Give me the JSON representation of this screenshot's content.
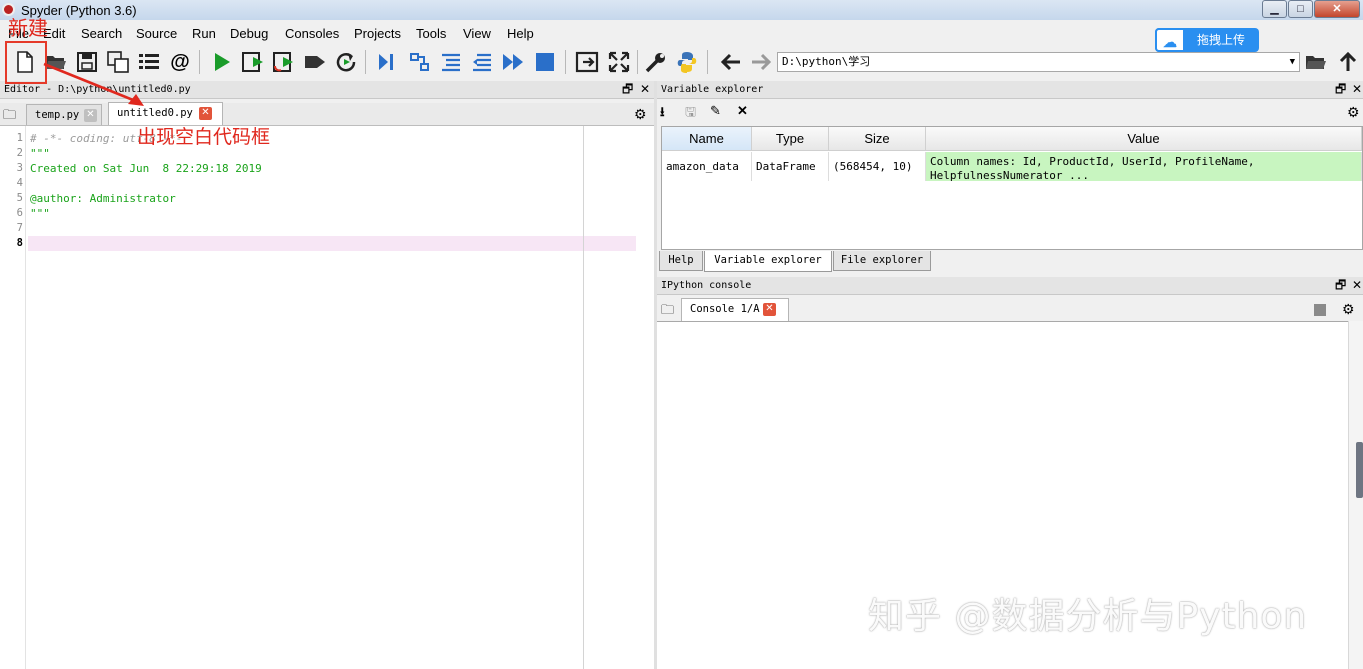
{
  "window": {
    "title": "Spyder (Python 3.6)",
    "min_label": "▁",
    "max_label": "□",
    "close_label": "✕"
  },
  "menu": [
    "File",
    "Edit",
    "Search",
    "Source",
    "Run",
    "Debug",
    "Consoles",
    "Projects",
    "Tools",
    "View",
    "Help"
  ],
  "cloud_button": {
    "label": "拖拽上传"
  },
  "toolbar": {
    "path": "D:\\python\\学习"
  },
  "editor": {
    "header": "Editor - D:\\python\\untitled0.py",
    "tabs": [
      {
        "label": "temp.py",
        "active": false
      },
      {
        "label": "untitled0.py",
        "active": true
      }
    ],
    "lines": [
      "# -*- coding: utf-8 -*-",
      "\"\"\"",
      "Created on Sat Jun  8 22:29:18 2019",
      "",
      "@author: Administrator",
      "\"\"\"",
      "",
      ""
    ],
    "line_numbers": [
      "1",
      "2",
      "3",
      "4",
      "5",
      "6",
      "7",
      "8"
    ],
    "current_line": "8"
  },
  "variable_explorer": {
    "header": "Variable explorer",
    "columns": [
      "Name",
      "Type",
      "Size",
      "Value"
    ],
    "rows": [
      {
        "name": "amazon_data",
        "type": "DataFrame",
        "size": "(568454, 10)",
        "value_line1": "Column names: Id, ProductId, UserId, ProfileName,",
        "value_line2": "HelpfulnessNumerator ..."
      }
    ],
    "bottom_tabs": [
      "Help",
      "Variable explorer",
      "File explorer"
    ],
    "active_tab": "Variable explorer"
  },
  "console": {
    "header": "IPython console",
    "tab_label": "Console 1/A"
  },
  "annotations": {
    "new_label": "新建",
    "blank_label": "出现空白代码框",
    "color": "#e0281e"
  },
  "watermark": "知乎 @数据分析与Python",
  "colors": {
    "run_green": "#1a9c2a",
    "string_green": "#1aa31a",
    "stop_blue": "#2a6fc9",
    "value_bg": "#c8f5c0"
  }
}
